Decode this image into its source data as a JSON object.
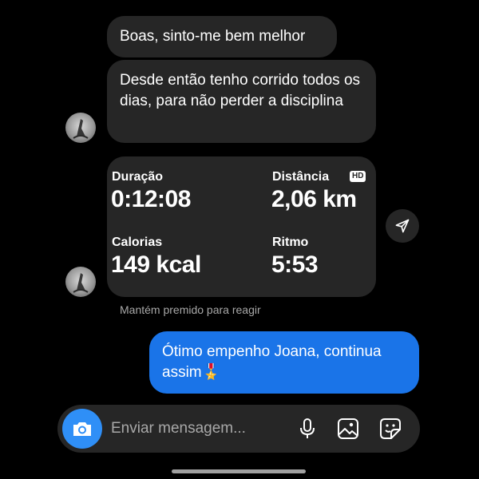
{
  "messages": {
    "msg1": "Boas, sinto-me bem melhor",
    "msg2": "Desde então tenho corrido todos os dias, para não perder a disciplina",
    "reply": "Ótimo empenho Joana, continua assim🎖️"
  },
  "workout": {
    "duracao_label": "Duração",
    "duracao_value": "0:12:08",
    "distancia_label": "Distância",
    "distancia_value": "2,06 km",
    "hd_badge": "HD",
    "calorias_label": "Calorias",
    "calorias_value": "149 kcal",
    "ritmo_label": "Ritmo",
    "ritmo_value": "5:53"
  },
  "hint": "Mantém premido para reagir",
  "composer": {
    "placeholder": "Enviar mensagem..."
  },
  "icons": {
    "avatar": "avatar-photo",
    "share": "paper-plane-icon",
    "camera": "camera-icon",
    "mic": "microphone-icon",
    "gallery": "gallery-icon",
    "sticker": "sticker-icon"
  },
  "colors": {
    "background": "#000000",
    "incoming_bubble": "#262626",
    "outgoing_bubble": "#1a74e8",
    "camera_button": "#2f8ff7",
    "hint_text": "#a8a8a8"
  }
}
